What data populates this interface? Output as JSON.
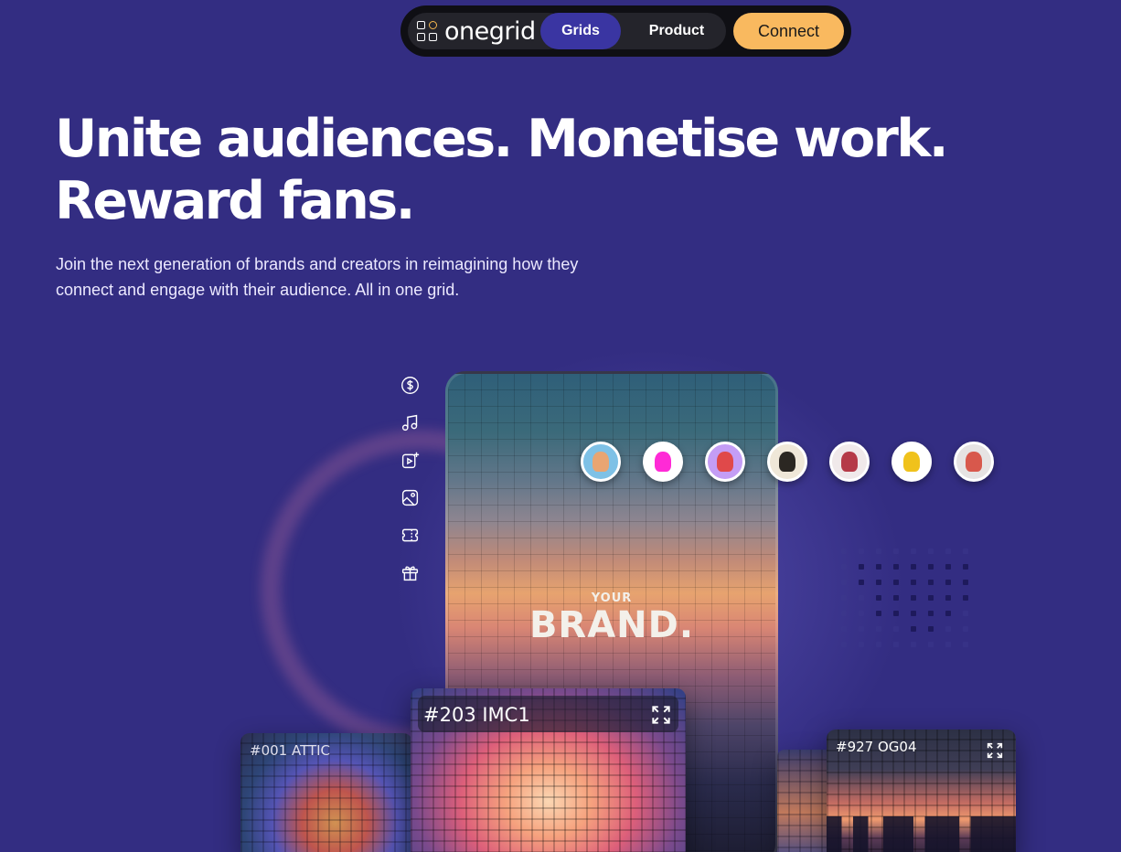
{
  "nav": {
    "logo_text": "onegrid",
    "items": [
      {
        "label": "Grids"
      },
      {
        "label": "Product"
      }
    ],
    "connect_label": "Connect"
  },
  "hero": {
    "headline_line1": "Unite audiences. Monetise work.",
    "headline_line2": "Reward fans.",
    "subhead_line1": "Join the next generation of brands and creators in reimagining how they",
    "subhead_line2": "connect and engage with their audience. All in one grid."
  },
  "showcase": {
    "toolbar_icons": [
      "dollar-coin-icon",
      "music-note-icon",
      "video-add-icon",
      "image-icon",
      "ticket-icon",
      "gift-icon"
    ],
    "brand_small": "YOUR",
    "brand_big": "BRAND.",
    "avatars": [
      {
        "bg": "#7ec1e6",
        "face": "#e8a572"
      },
      {
        "bg": "#ffffff",
        "face": "#ff2ad6"
      },
      {
        "bg": "#c49df5",
        "face": "#e0494a"
      },
      {
        "bg": "#efe7d8",
        "face": "#2b2722"
      },
      {
        "bg": "#f0e9ea",
        "face": "#b53a48"
      },
      {
        "bg": "#ffffff",
        "face": "#f0c21c"
      },
      {
        "bg": "#e6e3e3",
        "face": "#d8584c"
      }
    ],
    "cards": {
      "attic_label": "#001  ATTIC",
      "imc_label": "#203  IMC1",
      "og_label": "#927  OG04"
    }
  }
}
